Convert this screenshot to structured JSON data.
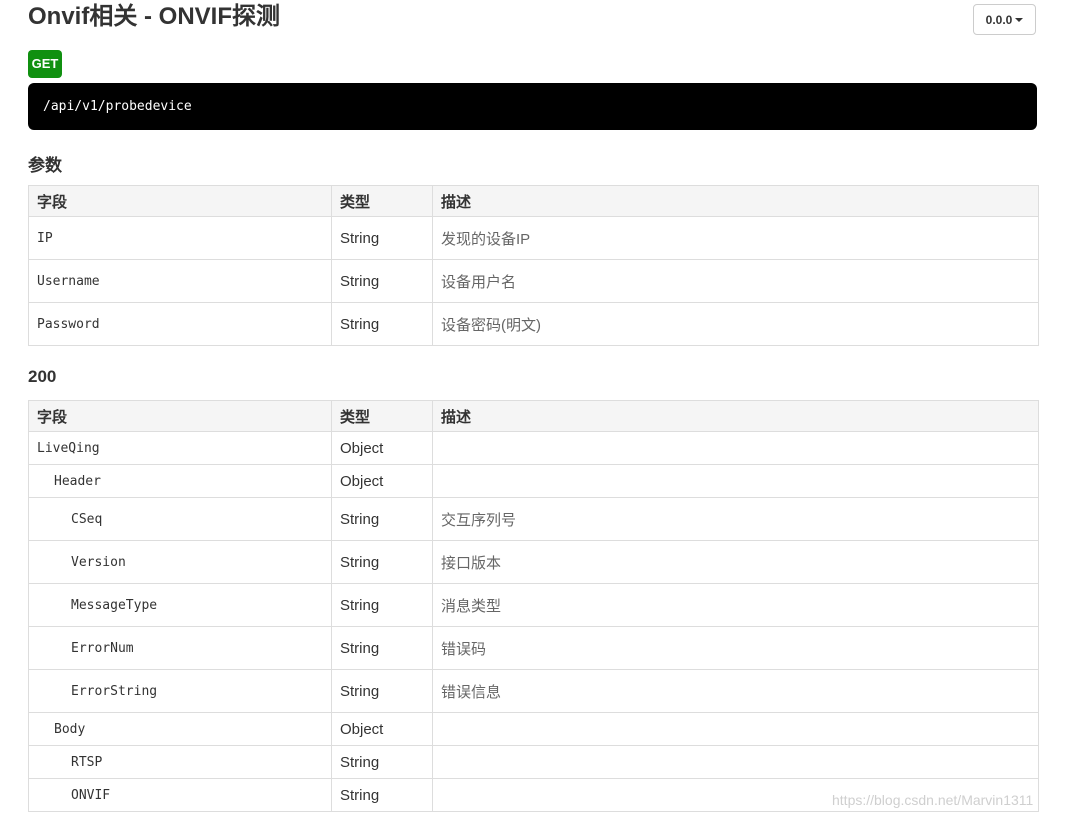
{
  "header": {
    "title": "Onvif相关 - ONVIF探测",
    "version": "0.0.0"
  },
  "endpoint": {
    "method": "GET",
    "path": "/api/v1/probedevice"
  },
  "params": {
    "title": "参数",
    "columns": [
      "字段",
      "类型",
      "描述"
    ],
    "rows": [
      {
        "field": "IP",
        "type": "String",
        "desc": "发现的设备IP"
      },
      {
        "field": "Username",
        "type": "String",
        "desc": "设备用户名"
      },
      {
        "field": "Password",
        "type": "String",
        "desc": "设备密码(明文)"
      }
    ]
  },
  "response": {
    "title": "200",
    "columns": [
      "字段",
      "类型",
      "描述"
    ],
    "rows": [
      {
        "field": "LiveQing",
        "type": "Object",
        "desc": ""
      },
      {
        "field": "Header",
        "type": "Object",
        "desc": ""
      },
      {
        "field": "CSeq",
        "type": "String",
        "desc": "交互序列号"
      },
      {
        "field": "Version",
        "type": "String",
        "desc": "接口版本"
      },
      {
        "field": "MessageType",
        "type": "String",
        "desc": "消息类型"
      },
      {
        "field": "ErrorNum",
        "type": "String",
        "desc": "错误码"
      },
      {
        "field": "ErrorString",
        "type": "String",
        "desc": "错误信息"
      },
      {
        "field": "Body",
        "type": "Object",
        "desc": ""
      },
      {
        "field": "RTSP",
        "type": "String",
        "desc": ""
      },
      {
        "field": "ONVIF",
        "type": "String",
        "desc": ""
      }
    ]
  },
  "watermark": "https://blog.csdn.net/Marvin1311"
}
